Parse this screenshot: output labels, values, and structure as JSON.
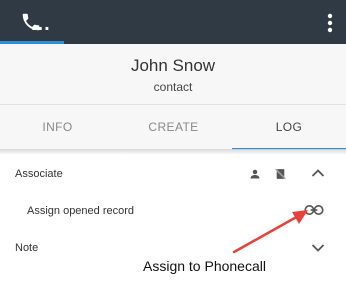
{
  "topbar": {
    "more_label": "..."
  },
  "contact": {
    "name": "John Snow",
    "type": "contact"
  },
  "tabs": [
    {
      "label": "INFO"
    },
    {
      "label": "CREATE"
    },
    {
      "label": "LOG"
    }
  ],
  "associate": {
    "label": "Associate",
    "assign_opened_record": "Assign opened record"
  },
  "note": {
    "label": "Note"
  },
  "annotation": {
    "text": "Assign to Phonecall",
    "color": "#e8403a"
  },
  "colors": {
    "topbar": "#2f3a45",
    "accent": "#2d8fd8"
  }
}
